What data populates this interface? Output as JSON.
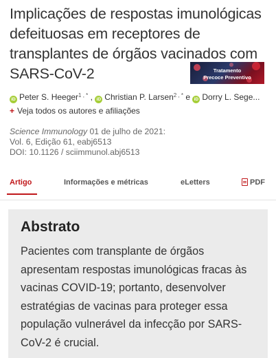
{
  "article": {
    "title": "Implicações de respostas imunológicas defeituosas em receptores de transplantes de órgãos vacinados com SARS-CoV-2",
    "ad_line1": "Tratamento",
    "ad_line2": "Precoce Preventivo"
  },
  "authors": [
    {
      "name": "Peter S. Heeger",
      "sup": "1 , *",
      "sep": " , "
    },
    {
      "name": "Christian P. Larsen",
      "sup": "2 , *",
      "sep": " e "
    },
    {
      "name": "Dorry L. Sege...",
      "sup": "",
      "sep": ""
    }
  ],
  "orcid_label": "iD",
  "view_all": "Veja todos os autores e afiliações",
  "citation": {
    "journal": "Science Immunology",
    "date": "01 de julho de 2021:",
    "volume": "Vol. 6, Edição 61, eabj6513",
    "doi": "DOI: 10.1126 / sciimmunol.abj6513"
  },
  "tabs": [
    {
      "label": "Artigo",
      "active": true
    },
    {
      "label": "Informações e métricas",
      "active": false
    },
    {
      "label": "eLetters",
      "active": false
    },
    {
      "label": "PDF",
      "active": false
    }
  ],
  "abstract": {
    "heading": "Abstrato",
    "text": "Pacientes com transplante de órgãos apresentam respostas imunológicas fracas às vacinas COVID-19; portanto, desenvolver estratégias de vacinas para proteger essa população vulnerável da infecção por SARS-CoV-2 é crucial."
  },
  "colors": {
    "accent": "#c0171a",
    "orcid": "#a6ce39",
    "abstract_bg": "#ebebeb"
  },
  "icons": {
    "orcid": "orcid-icon",
    "pdf": "pdf-icon",
    "plus": "plus-icon"
  }
}
